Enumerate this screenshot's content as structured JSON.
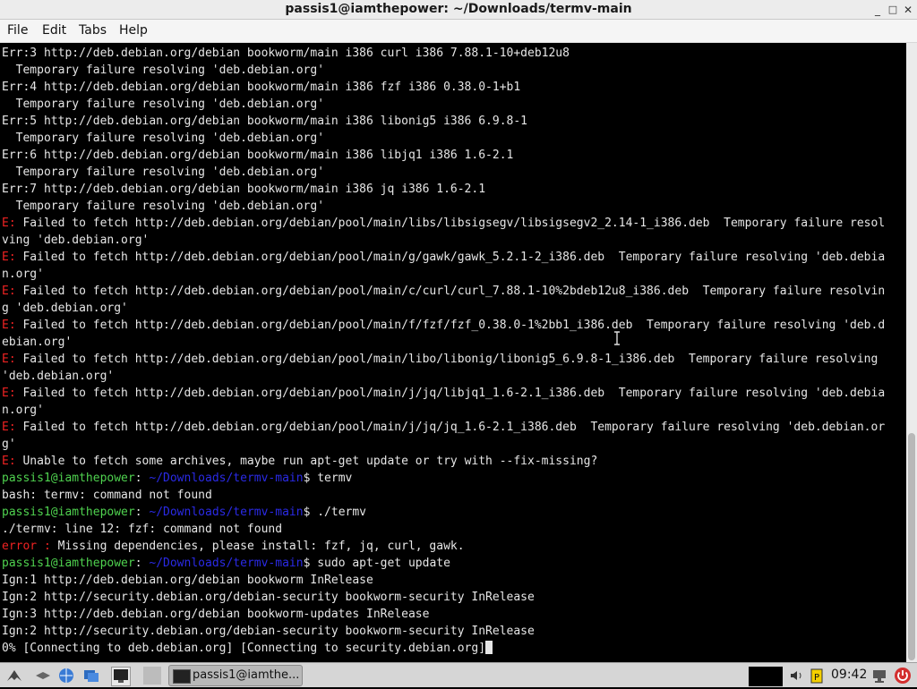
{
  "window": {
    "title": "passis1@iamthepower: ~/Downloads/termv-main",
    "minimize_glyph": "_",
    "maximize_glyph": "□",
    "close_glyph": "✕"
  },
  "menu": [
    "File",
    "Edit",
    "Tabs",
    "Help"
  ],
  "terminal": {
    "lines": [
      [
        {
          "t": "Err:3 http://deb.debian.org/debian bookworm/main i386 curl i386 7.88.1-10+deb12u8"
        }
      ],
      [
        {
          "t": "  Temporary failure resolving 'deb.debian.org'"
        }
      ],
      [
        {
          "t": "Err:4 http://deb.debian.org/debian bookworm/main i386 fzf i386 0.38.0-1+b1"
        }
      ],
      [
        {
          "t": "  Temporary failure resolving 'deb.debian.org'"
        }
      ],
      [
        {
          "t": "Err:5 http://deb.debian.org/debian bookworm/main i386 libonig5 i386 6.9.8-1"
        }
      ],
      [
        {
          "t": "  Temporary failure resolving 'deb.debian.org'"
        }
      ],
      [
        {
          "t": "Err:6 http://deb.debian.org/debian bookworm/main i386 libjq1 i386 1.6-2.1"
        }
      ],
      [
        {
          "t": "  Temporary failure resolving 'deb.debian.org'"
        }
      ],
      [
        {
          "t": "Err:7 http://deb.debian.org/debian bookworm/main i386 jq i386 1.6-2.1"
        }
      ],
      [
        {
          "t": "  Temporary failure resolving 'deb.debian.org'"
        }
      ],
      [
        {
          "t": "E:",
          "c": "red"
        },
        {
          "t": " Failed to fetch http://deb.debian.org/debian/pool/main/libs/libsigsegv/libsigsegv2_2.14-1_i386.deb  Temporary failure resol"
        }
      ],
      [
        {
          "t": "ving 'deb.debian.org'"
        }
      ],
      [
        {
          "t": "E:",
          "c": "red"
        },
        {
          "t": " Failed to fetch http://deb.debian.org/debian/pool/main/g/gawk/gawk_5.2.1-2_i386.deb  Temporary failure resolving 'deb.debia"
        }
      ],
      [
        {
          "t": "n.org'"
        }
      ],
      [
        {
          "t": "E:",
          "c": "red"
        },
        {
          "t": " Failed to fetch http://deb.debian.org/debian/pool/main/c/curl/curl_7.88.1-10%2bdeb12u8_i386.deb  Temporary failure resolvin"
        }
      ],
      [
        {
          "t": "g 'deb.debian.org'"
        }
      ],
      [
        {
          "t": "E:",
          "c": "red"
        },
        {
          "t": " Failed to fetch http://deb.debian.org/debian/pool/main/f/fzf/fzf_0.38.0-1%2bb1_i386.deb  Temporary failure resolving 'deb.d"
        }
      ],
      [
        {
          "t": "ebian.org'"
        }
      ],
      [
        {
          "t": "E:",
          "c": "red"
        },
        {
          "t": " Failed to fetch http://deb.debian.org/debian/pool/main/libo/libonig/libonig5_6.9.8-1_i386.deb  Temporary failure resolving"
        }
      ],
      [
        {
          "t": "'deb.debian.org'"
        }
      ],
      [
        {
          "t": "E:",
          "c": "red"
        },
        {
          "t": " Failed to fetch http://deb.debian.org/debian/pool/main/j/jq/libjq1_1.6-2.1_i386.deb  Temporary failure resolving 'deb.debia"
        }
      ],
      [
        {
          "t": "n.org'"
        }
      ],
      [
        {
          "t": "E:",
          "c": "red"
        },
        {
          "t": " Failed to fetch http://deb.debian.org/debian/pool/main/j/jq/jq_1.6-2.1_i386.deb  Temporary failure resolving 'deb.debian.or"
        }
      ],
      [
        {
          "t": "g'"
        }
      ],
      [
        {
          "t": "E:",
          "c": "red"
        },
        {
          "t": " Unable to fetch some archives, maybe run apt-get update or try with --fix-missing?"
        }
      ],
      [
        {
          "t": "passis1@iamthepower",
          "c": "green"
        },
        {
          "t": ": "
        },
        {
          "t": "~/Downloads/termv-main",
          "c": "blue"
        },
        {
          "t": "$ termv"
        }
      ],
      [
        {
          "t": "bash: termv: command not found"
        }
      ],
      [
        {
          "t": "passis1@iamthepower",
          "c": "green"
        },
        {
          "t": ": "
        },
        {
          "t": "~/Downloads/termv-main",
          "c": "blue"
        },
        {
          "t": "$ ./termv"
        }
      ],
      [
        {
          "t": "./termv: line 12: fzf: command not found"
        }
      ],
      [
        {
          "t": "error :",
          "c": "red"
        },
        {
          "t": " Missing dependencies, please install: fzf, jq, curl, gawk."
        }
      ],
      [
        {
          "t": "passis1@iamthepower",
          "c": "green"
        },
        {
          "t": ": "
        },
        {
          "t": "~/Downloads/termv-main",
          "c": "blue"
        },
        {
          "t": "$ sudo apt-get update"
        }
      ],
      [
        {
          "t": "Ign:1 http://deb.debian.org/debian bookworm InRelease"
        }
      ],
      [
        {
          "t": "Ign:2 http://security.debian.org/debian-security bookworm-security InRelease"
        }
      ],
      [
        {
          "t": "Ign:3 http://deb.debian.org/debian bookworm-updates InRelease"
        }
      ],
      [
        {
          "t": "Ign:2 http://security.debian.org/debian-security bookworm-security InRelease"
        }
      ],
      [
        {
          "t": "0% [Connecting to deb.debian.org] [Connecting to security.debian.org]"
        }
      ]
    ],
    "colors": {
      "red": "#ee2222",
      "green": "#4fd24f",
      "blue": "#2a2ae6",
      "text": "#e6e6e6"
    }
  },
  "taskbar": {
    "start_icon": "start-menu-icon",
    "task_label": "passis1@iamthe...",
    "clock": "09:42"
  }
}
